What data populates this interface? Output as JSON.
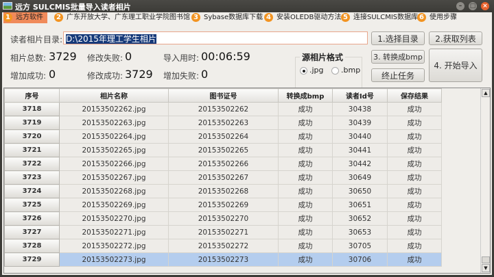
{
  "window": {
    "title": "远方 SULCMIS批量导入读者相片"
  },
  "tabs": [
    {
      "num": "1",
      "label": "远方软件"
    },
    {
      "num": "2",
      "label": "广东开放大学、广东理工职业学院图书馆"
    },
    {
      "num": "3",
      "label": "Sybase数据库下载"
    },
    {
      "num": "4",
      "label": "安装OLEDB驱动方法"
    },
    {
      "num": "5",
      "label": "连接SULCMIS数据库"
    },
    {
      "num": "6",
      "label": "使用步骤"
    }
  ],
  "form": {
    "dir_label": "读者相片目录:",
    "dir_value": "D:\\2015年理工学生相片",
    "total_label": "相片总数:",
    "total": "3729",
    "modfail_label": "修改失败:",
    "modfail": "0",
    "time_label": "导入用时:",
    "time": "00:06:59",
    "addok_label": "增加成功:",
    "addok": "0",
    "modok_label": "修改成功:",
    "modok": "3729",
    "addfail_label": "增加失败:",
    "addfail": "0",
    "format_group": "源相片格式",
    "opt_jpg": ".jpg",
    "opt_bmp": ".bmp",
    "selected_format": ".jpg"
  },
  "buttons": {
    "select_dir": "1.选择目录",
    "get_list": "2.获取列表",
    "convert": "3. 转换成bmp",
    "stop": "终止任务",
    "start": "4. 开始导入"
  },
  "table": {
    "headers": [
      "序号",
      "相片名称",
      "图书证号",
      "转换成bmp",
      "读者Id号",
      "保存结果"
    ],
    "rows": [
      [
        "3718",
        "20153502262.jpg",
        "20153502262",
        "成功",
        "30438",
        "成功"
      ],
      [
        "3719",
        "20153502263.jpg",
        "20153502263",
        "成功",
        "30439",
        "成功"
      ],
      [
        "3720",
        "20153502264.jpg",
        "20153502264",
        "成功",
        "30440",
        "成功"
      ],
      [
        "3721",
        "20153502265.jpg",
        "20153502265",
        "成功",
        "30441",
        "成功"
      ],
      [
        "3722",
        "20153502266.jpg",
        "20153502266",
        "成功",
        "30442",
        "成功"
      ],
      [
        "3723",
        "20153502267.jpg",
        "20153502267",
        "成功",
        "30649",
        "成功"
      ],
      [
        "3724",
        "20153502268.jpg",
        "20153502268",
        "成功",
        "30650",
        "成功"
      ],
      [
        "3725",
        "20153502269.jpg",
        "20153502269",
        "成功",
        "30651",
        "成功"
      ],
      [
        "3726",
        "20153502270.jpg",
        "20153502270",
        "成功",
        "30652",
        "成功"
      ],
      [
        "3727",
        "20153502271.jpg",
        "20153502271",
        "成功",
        "30653",
        "成功"
      ],
      [
        "3728",
        "20153502272.jpg",
        "20153502272",
        "成功",
        "30705",
        "成功"
      ],
      [
        "3729",
        "20153502273.jpg",
        "20153502273",
        "成功",
        "30706",
        "成功"
      ]
    ],
    "selected_row": "3729"
  }
}
